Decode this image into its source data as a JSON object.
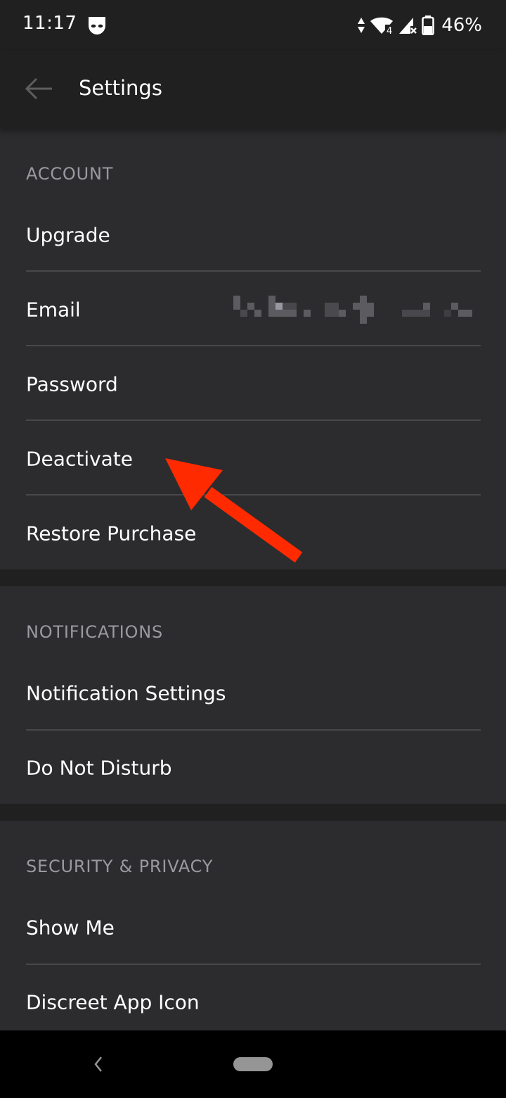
{
  "status_bar": {
    "time": "11:17",
    "notification_icon": "grindr-mask-icon",
    "icons": [
      "data-activity-icon",
      "wifi-icon",
      "cell-signal-no-service-icon",
      "battery-icon"
    ],
    "wifi_badge": "4",
    "battery_percent": "46%"
  },
  "app_bar": {
    "back_icon": "arrow-left-icon",
    "title": "Settings"
  },
  "sections": [
    {
      "header": "ACCOUNT",
      "rows": [
        {
          "label": "Upgrade"
        },
        {
          "label": "Email",
          "value": "[redacted]"
        },
        {
          "label": "Password"
        },
        {
          "label": "Deactivate"
        },
        {
          "label": "Restore Purchase"
        }
      ]
    },
    {
      "header": "NOTIFICATIONS",
      "rows": [
        {
          "label": "Notification Settings"
        },
        {
          "label": "Do Not Disturb"
        }
      ]
    },
    {
      "header": "SECURITY & PRIVACY",
      "rows": [
        {
          "label": "Show Me"
        },
        {
          "label": "Discreet App Icon"
        }
      ]
    }
  ],
  "annotation": {
    "type": "arrow",
    "points_to": "Deactivate",
    "color": "#ff2a00"
  },
  "nav_bar": {
    "back_icon": "chevron-left-icon",
    "home_icon": "home-pill-icon"
  },
  "colors": {
    "background": "#202020",
    "section_bg": "#2c2c2e",
    "header_text": "#9a99a0",
    "divider": "#48484b",
    "row_text": "#ffffff"
  }
}
